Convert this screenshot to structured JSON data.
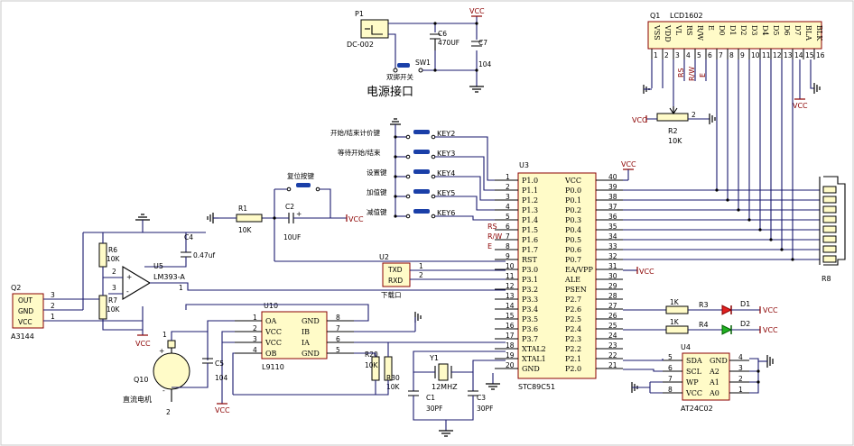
{
  "diagram": {
    "power_section_title": "电源接口",
    "p1": {
      "ref": "P1",
      "part": "DC-002"
    },
    "sw1": {
      "ref": "SW1",
      "label": "双掷开关"
    },
    "c6": {
      "ref": "C6",
      "value": "470UF"
    },
    "c7": {
      "ref": "C7",
      "value": "104"
    },
    "vcc": "VCC",
    "lcd": {
      "ref": "Q1",
      "part": "LCD1602",
      "pins": [
        "VSS",
        "VDD",
        "VL",
        "RS",
        "R/W",
        "E",
        "D0",
        "D1",
        "D2",
        "D3",
        "D4",
        "D5",
        "D6",
        "D7",
        "BLA",
        "BLK"
      ],
      "nums": [
        "1",
        "2",
        "3",
        "4",
        "5",
        "6",
        "7",
        "8",
        "9",
        "10",
        "11",
        "12",
        "13",
        "14",
        "15",
        "16"
      ],
      "net_labels": [
        "RS",
        "R/W",
        "E"
      ]
    },
    "r2": {
      "ref": "R2",
      "value": "10K"
    },
    "keys": [
      {
        "ref": "KEY2",
        "label": "开始/结束计价键"
      },
      {
        "ref": "KEY3",
        "label": "等待开始/结束"
      },
      {
        "ref": "KEY4",
        "label": "设置键"
      },
      {
        "ref": "KEY5",
        "label": "加值键"
      },
      {
        "ref": "KEY6",
        "label": "减值键"
      }
    ],
    "reset": {
      "label": "复位按键",
      "c2": "C2",
      "c2v": "10UF",
      "r1": "R1",
      "r1v": "10K"
    },
    "u3": {
      "ref": "U3",
      "part": "STC89C51",
      "left": [
        {
          "n": "1",
          "p": "P1.0"
        },
        {
          "n": "2",
          "p": "P1.1"
        },
        {
          "n": "3",
          "p": "P1.2"
        },
        {
          "n": "4",
          "p": "P1.3"
        },
        {
          "n": "5",
          "p": "P1.4"
        },
        {
          "n": "6",
          "p": "P1.5"
        },
        {
          "n": "7",
          "p": "P1.6"
        },
        {
          "n": "8",
          "p": "P1.7"
        },
        {
          "n": "9",
          "p": "RST"
        },
        {
          "n": "10",
          "p": "P3.0"
        },
        {
          "n": "11",
          "p": "P3.1"
        },
        {
          "n": "12",
          "p": "P3.2"
        },
        {
          "n": "13",
          "p": "P3.3"
        },
        {
          "n": "14",
          "p": "P3.4"
        },
        {
          "n": "15",
          "p": "P3.5"
        },
        {
          "n": "16",
          "p": "P3.6"
        },
        {
          "n": "17",
          "p": "P3.7"
        },
        {
          "n": "18",
          "p": "XTAL2"
        },
        {
          "n": "19",
          "p": "XTAL1"
        },
        {
          "n": "20",
          "p": "GND"
        }
      ],
      "right": [
        {
          "n": "40",
          "p": "VCC"
        },
        {
          "n": "39",
          "p": "P0.0"
        },
        {
          "n": "38",
          "p": "P0.1"
        },
        {
          "n": "37",
          "p": "P0.2"
        },
        {
          "n": "36",
          "p": "P0.3"
        },
        {
          "n": "35",
          "p": "P0.4"
        },
        {
          "n": "34",
          "p": "P0.5"
        },
        {
          "n": "33",
          "p": "P0.6"
        },
        {
          "n": "32",
          "p": "P0.7"
        },
        {
          "n": "31",
          "p": "EA/VPP"
        },
        {
          "n": "30",
          "p": "ALE"
        },
        {
          "n": "29",
          "p": "PSEN"
        },
        {
          "n": "28",
          "p": "P2.7"
        },
        {
          "n": "27",
          "p": "P2.6"
        },
        {
          "n": "26",
          "p": "P2.5"
        },
        {
          "n": "25",
          "p": "P2.4"
        },
        {
          "n": "24",
          "p": "P2.3"
        },
        {
          "n": "23",
          "p": "P2.2"
        },
        {
          "n": "22",
          "p": "P2.1"
        },
        {
          "n": "21",
          "p": "P2.0"
        }
      ],
      "left_net_labels": [
        "RS",
        "R/W",
        "E"
      ]
    },
    "u2": {
      "ref": "U2",
      "txd": "TXD",
      "rxd": "RXD",
      "label": "下载口",
      "n1": "1",
      "n2": "2"
    },
    "r8": {
      "ref": "R8"
    },
    "u5": {
      "ref": "U5",
      "part": "LM393-A",
      "c4": "C4",
      "c4v": "0.47uf",
      "r6": "R6",
      "r6v": "10K",
      "r7": "R7",
      "r7v": "10K",
      "pin_in_p": "3",
      "pin_in_n": "2",
      "pin_out": "1"
    },
    "q2": {
      "ref": "Q2",
      "part": "A3144",
      "out": "OUT",
      "gnd": "GND",
      "vcc": "VCC",
      "n3": "3",
      "n2": "2",
      "n1": "1"
    },
    "u10": {
      "ref": "U10",
      "part": "L9110",
      "left": [
        {
          "n": "1",
          "p": "OA"
        },
        {
          "n": "2",
          "p": "VCC"
        },
        {
          "n": "3",
          "p": "VCC"
        },
        {
          "n": "4",
          "p": "OB"
        }
      ],
      "right": [
        {
          "n": "8",
          "p": "GND"
        },
        {
          "n": "7",
          "p": "IB"
        },
        {
          "n": "6",
          "p": "IA"
        },
        {
          "n": "5",
          "p": "GND"
        }
      ]
    },
    "q10": {
      "ref": "Q10",
      "label": "直流电机",
      "c5": "C5",
      "c5v": "104",
      "n1": "1",
      "n2": "2"
    },
    "r20": {
      "ref": "R20",
      "value": "10K"
    },
    "r30": {
      "ref": "R30",
      "value": "10K"
    },
    "y1": {
      "ref": "Y1",
      "value": "12MHZ",
      "c1": "C1",
      "c1v": "30PF",
      "c3": "C3",
      "c3v": "30PF"
    },
    "leds": [
      {
        "r": "R3",
        "rv": "1K",
        "d": "D1"
      },
      {
        "r": "R4",
        "rv": "1K",
        "d": "D2"
      }
    ],
    "u4": {
      "ref": "U4",
      "part": "AT24C02",
      "left": [
        {
          "n": "5",
          "p": "SDA"
        },
        {
          "n": "6",
          "p": "SCL"
        },
        {
          "n": "7",
          "p": "WP"
        },
        {
          "n": "8",
          "p": "VCC"
        }
      ],
      "right": [
        {
          "n": "4",
          "p": "GND"
        },
        {
          "n": "3",
          "p": "A2"
        },
        {
          "n": "2",
          "p": "A1"
        },
        {
          "n": "1",
          "p": "A0"
        }
      ]
    }
  }
}
